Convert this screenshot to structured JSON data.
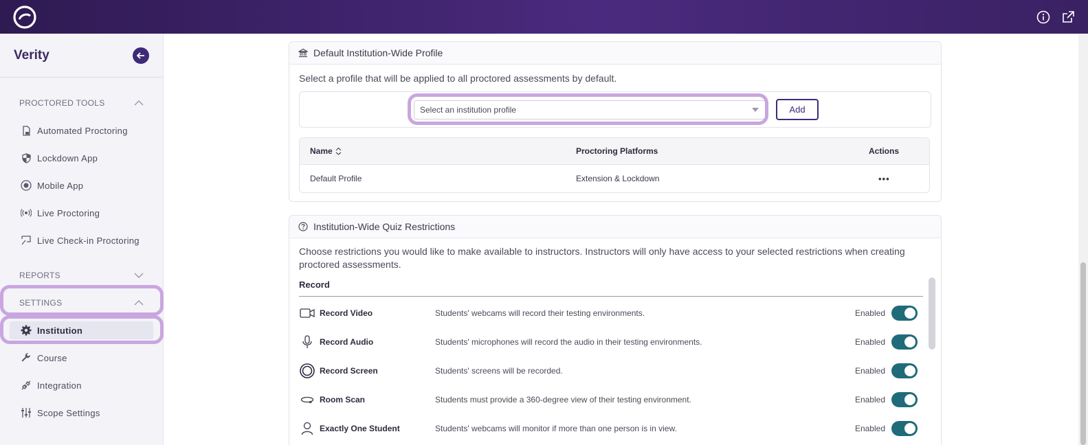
{
  "app": {
    "logo": "brand-logo-icon"
  },
  "topbar": {
    "icons": [
      "info-icon",
      "external-link-icon"
    ]
  },
  "sidebar": {
    "title": "Verity",
    "sections": [
      {
        "label": "PROCTORED TOOLS",
        "expanded": true
      },
      {
        "label": "REPORTS",
        "expanded": false
      },
      {
        "label": "SETTINGS",
        "expanded": true
      }
    ],
    "proctored_items": [
      {
        "label": "Automated Proctoring",
        "icon": "document-icon"
      },
      {
        "label": "Lockdown App",
        "icon": "shield-icon"
      },
      {
        "label": "Mobile App",
        "icon": "mobile-globe-icon"
      },
      {
        "label": "Live Proctoring",
        "icon": "broadcast-icon"
      },
      {
        "label": "Live Check-in Proctoring",
        "icon": "checkin-icon"
      }
    ],
    "settings_items": [
      {
        "label": "Institution",
        "icon": "gear-icon",
        "active": true
      },
      {
        "label": "Course",
        "icon": "wrench-icon"
      },
      {
        "label": "Integration",
        "icon": "plug-icon"
      },
      {
        "label": "Scope Settings",
        "icon": "sliders-icon"
      }
    ]
  },
  "default_profile": {
    "header": "Default Institution-Wide Profile",
    "description": "Select a profile that will be applied to all proctored assessments by default.",
    "dropdown_placeholder": "Select an institution profile",
    "add_label": "Add",
    "table": {
      "columns": [
        "Name",
        "Proctoring Platforms",
        "Actions"
      ],
      "rows": [
        {
          "name": "Default Profile",
          "platforms": "Extension & Lockdown",
          "actions": "•••"
        }
      ]
    }
  },
  "quiz_restrictions": {
    "header": "Institution-Wide Quiz Restrictions",
    "description": "Choose restrictions you would like to make available to instructors. Instructors will only have access to your selected restrictions when creating proctored assessments.",
    "group_title": "Record",
    "items": [
      {
        "name": "Record Video",
        "desc": "Students' webcams will record their testing environments.",
        "status": "Enabled",
        "icon": "video-camera-icon"
      },
      {
        "name": "Record Audio",
        "desc": "Students' microphones will record the audio in their testing environments.",
        "status": "Enabled",
        "icon": "microphone-icon"
      },
      {
        "name": "Record Screen",
        "desc": "Students' screens will be recorded.",
        "status": "Enabled",
        "icon": "screen-record-icon"
      },
      {
        "name": "Room Scan",
        "desc": "Students must provide a 360-degree view of their testing environment.",
        "status": "Enabled",
        "icon": "room-scan-icon"
      },
      {
        "name": "Exactly One Student",
        "desc": "Students' webcams will monitor if more than one person is in view.",
        "status": "Enabled",
        "icon": "person-icon"
      }
    ]
  },
  "colors": {
    "accent": "#3f2a78",
    "toggle_on": "#1f6b7a",
    "highlight": "#c9a6e0"
  }
}
